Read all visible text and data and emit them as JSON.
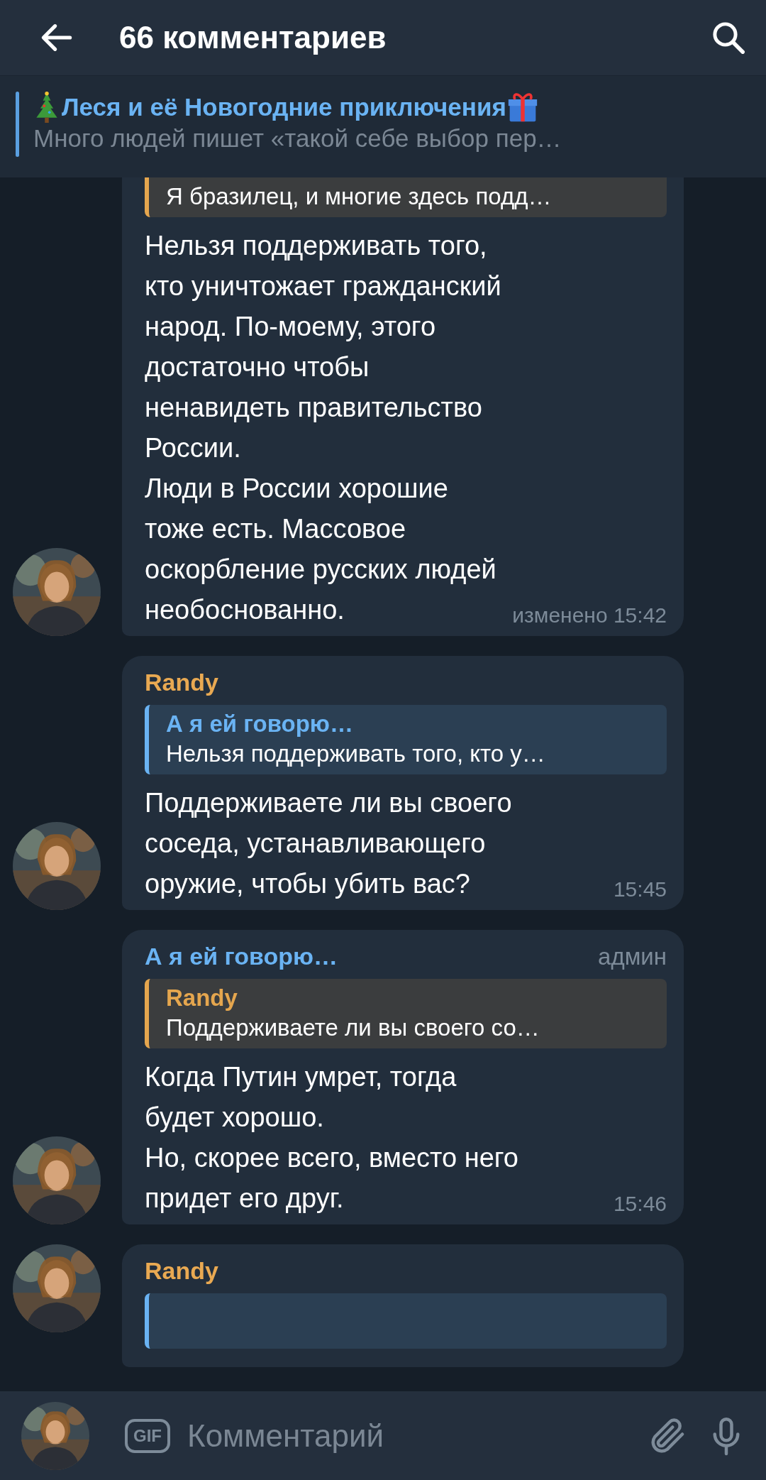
{
  "header": {
    "title": "66 комментариев"
  },
  "pinned": {
    "title": "Леся и её Новогодние приключения",
    "text": "Много людей пишет «такой себе выбор пер…"
  },
  "messages": [
    {
      "quote": {
        "color": "#e5a64e",
        "text": "Я бразилец, и многие здесь подд…"
      },
      "text": "Нельзя поддерживать того,\nкто уничтожает гражданский\nнарод. По-моему, этого\nдостаточно чтобы\nненавидеть правительство\nРоссии.\nЛюди в России хорошие\nтоже есть. Массовое\nоскорбление русских людей\nнеобоснованно.",
      "meta": "изменено 15:42"
    },
    {
      "sender": {
        "name": "Randy",
        "color": "#e9a952"
      },
      "quote": {
        "author": "А я ей говорю…",
        "color": "#6ab3f3",
        "text": "Нельзя поддерживать того, кто у…"
      },
      "text": "Поддерживаете ли вы своего\nсоседа, устанавливающего\nоружие, чтобы убить вас?",
      "meta": "15:45"
    },
    {
      "sender": {
        "name": "А я ей говорю…",
        "color": "#6ab3f3"
      },
      "role": "админ",
      "quote": {
        "author": "Randy",
        "color": "#e5a64e",
        "text": "Поддерживаете ли вы своего со…"
      },
      "text": "Когда Путин умрет, тогда\nбудет хорошо.\nНо, скорее всего, вместо него\nпридет его друг.",
      "meta": "15:46"
    },
    {
      "sender": {
        "name": "Randy",
        "color": "#e9a952"
      },
      "quote": {
        "color": "#6ab3f3"
      }
    }
  ],
  "composer": {
    "gif_label": "GIF",
    "placeholder": "Комментарий"
  }
}
